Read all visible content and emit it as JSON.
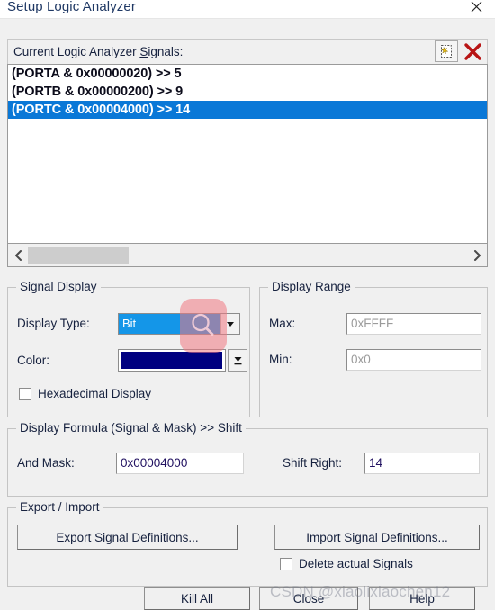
{
  "window": {
    "title": "Setup Logic Analyzer",
    "close_icon": "close-icon"
  },
  "signals": {
    "label_pre": "Current Logic Analyzer ",
    "label_accel": "S",
    "label_post": "ignals:",
    "full_label": "Current Logic Analyzer Signals:",
    "new_icon": "new-signal-icon",
    "delete_icon": "delete-signal-icon",
    "items": [
      {
        "text": "(PORTA & 0x00000020) >> 5",
        "selected": false
      },
      {
        "text": "(PORTB & 0x00000200) >> 9",
        "selected": false
      },
      {
        "text": "(PORTC & 0x00004000) >> 14",
        "selected": true
      }
    ],
    "scroll_left_icon": "chevron-left-icon",
    "scroll_right_icon": "chevron-right-icon"
  },
  "signal_display": {
    "legend": "Signal Display",
    "display_type_label": "Display Type:",
    "display_type_value": "Bit",
    "color_label": "Color:",
    "color_value": "#000080",
    "hex_display_label": "Hexadecimal Display",
    "hex_display_checked": false
  },
  "display_range": {
    "legend": "Display Range",
    "max_label": "Max:",
    "max_value": "0xFFFF",
    "min_label": "Min:",
    "min_value": "0x0"
  },
  "display_formula": {
    "legend": "Display Formula (Signal & Mask) >> Shift",
    "and_mask_label": "And Mask:",
    "and_mask_value": "0x00004000",
    "shift_right_label": "Shift Right:",
    "shift_right_value": "14"
  },
  "export_import": {
    "legend": "Export / Import",
    "export_button": "Export Signal Definitions...",
    "import_button": "Import Signal Definitions...",
    "delete_actual_label": "Delete actual Signals",
    "delete_actual_checked": false
  },
  "footer": {
    "kill_all": "Kill All",
    "close": "Close",
    "help": "Help"
  },
  "watermark": {
    "text": "CSDN @xiaolixiaochen12"
  },
  "cursor": {
    "overlay_icon": "magnifier-icon"
  }
}
